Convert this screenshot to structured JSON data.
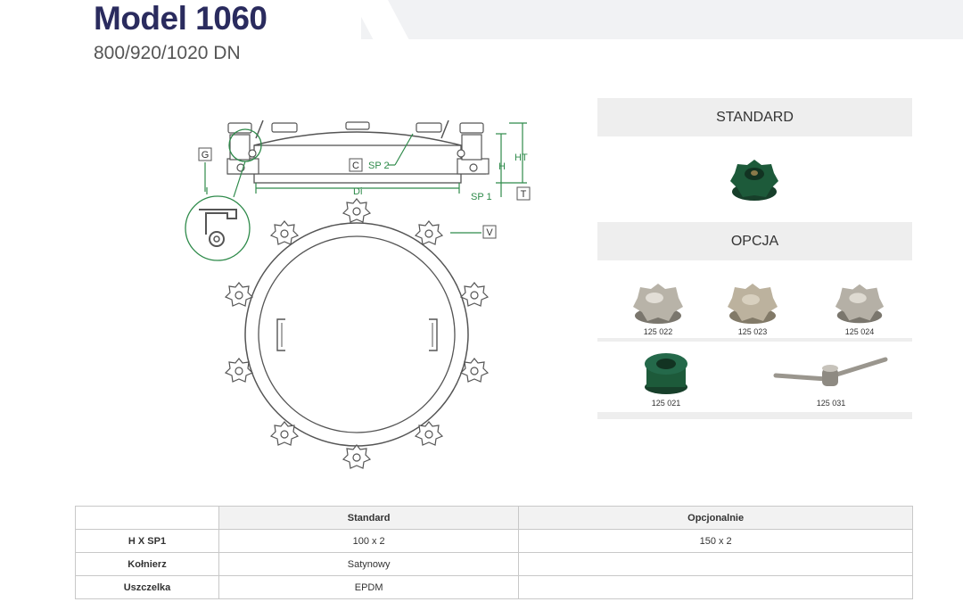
{
  "header": {
    "title": "Model 1060",
    "subtitle": "800/920/1020 DN"
  },
  "drawing": {
    "labels": {
      "g": "G",
      "c": "C",
      "sp2": "SP 2",
      "h": "H",
      "ht": "HT",
      "sp1": "SP 1",
      "t": "T",
      "di": "Di",
      "v": "V"
    },
    "colors": {
      "dimension": "#2e8a4a",
      "outline": "#555555"
    }
  },
  "options_panel": {
    "standard_heading": "STANDARD",
    "option_heading": "OPCJA",
    "standard_knob": {
      "icon": "green-star-knob-icon"
    },
    "option_knobs": [
      {
        "code": "125 022",
        "icon": "steel-star-knob-icon"
      },
      {
        "code": "125 023",
        "icon": "steel-star-knob-icon"
      },
      {
        "code": "125 024",
        "icon": "steel-star-knob-icon"
      },
      {
        "code": "125 021",
        "icon": "green-star-knob-icon"
      },
      {
        "code": "125 031",
        "icon": "wing-handle-icon"
      }
    ],
    "colors": {
      "green": "#1d5a3a",
      "steel": "#b8b3a8"
    }
  },
  "spec_table": {
    "headers": [
      "",
      "Standard",
      "Opcjonalnie"
    ],
    "rows": [
      {
        "label": "H X SP1",
        "standard": "100 x 2",
        "optional": "150 x 2"
      },
      {
        "label": "Kołnierz",
        "standard": "Satynowy",
        "optional": ""
      },
      {
        "label": "Uszczelka",
        "standard": "EPDM",
        "optional": ""
      }
    ]
  }
}
